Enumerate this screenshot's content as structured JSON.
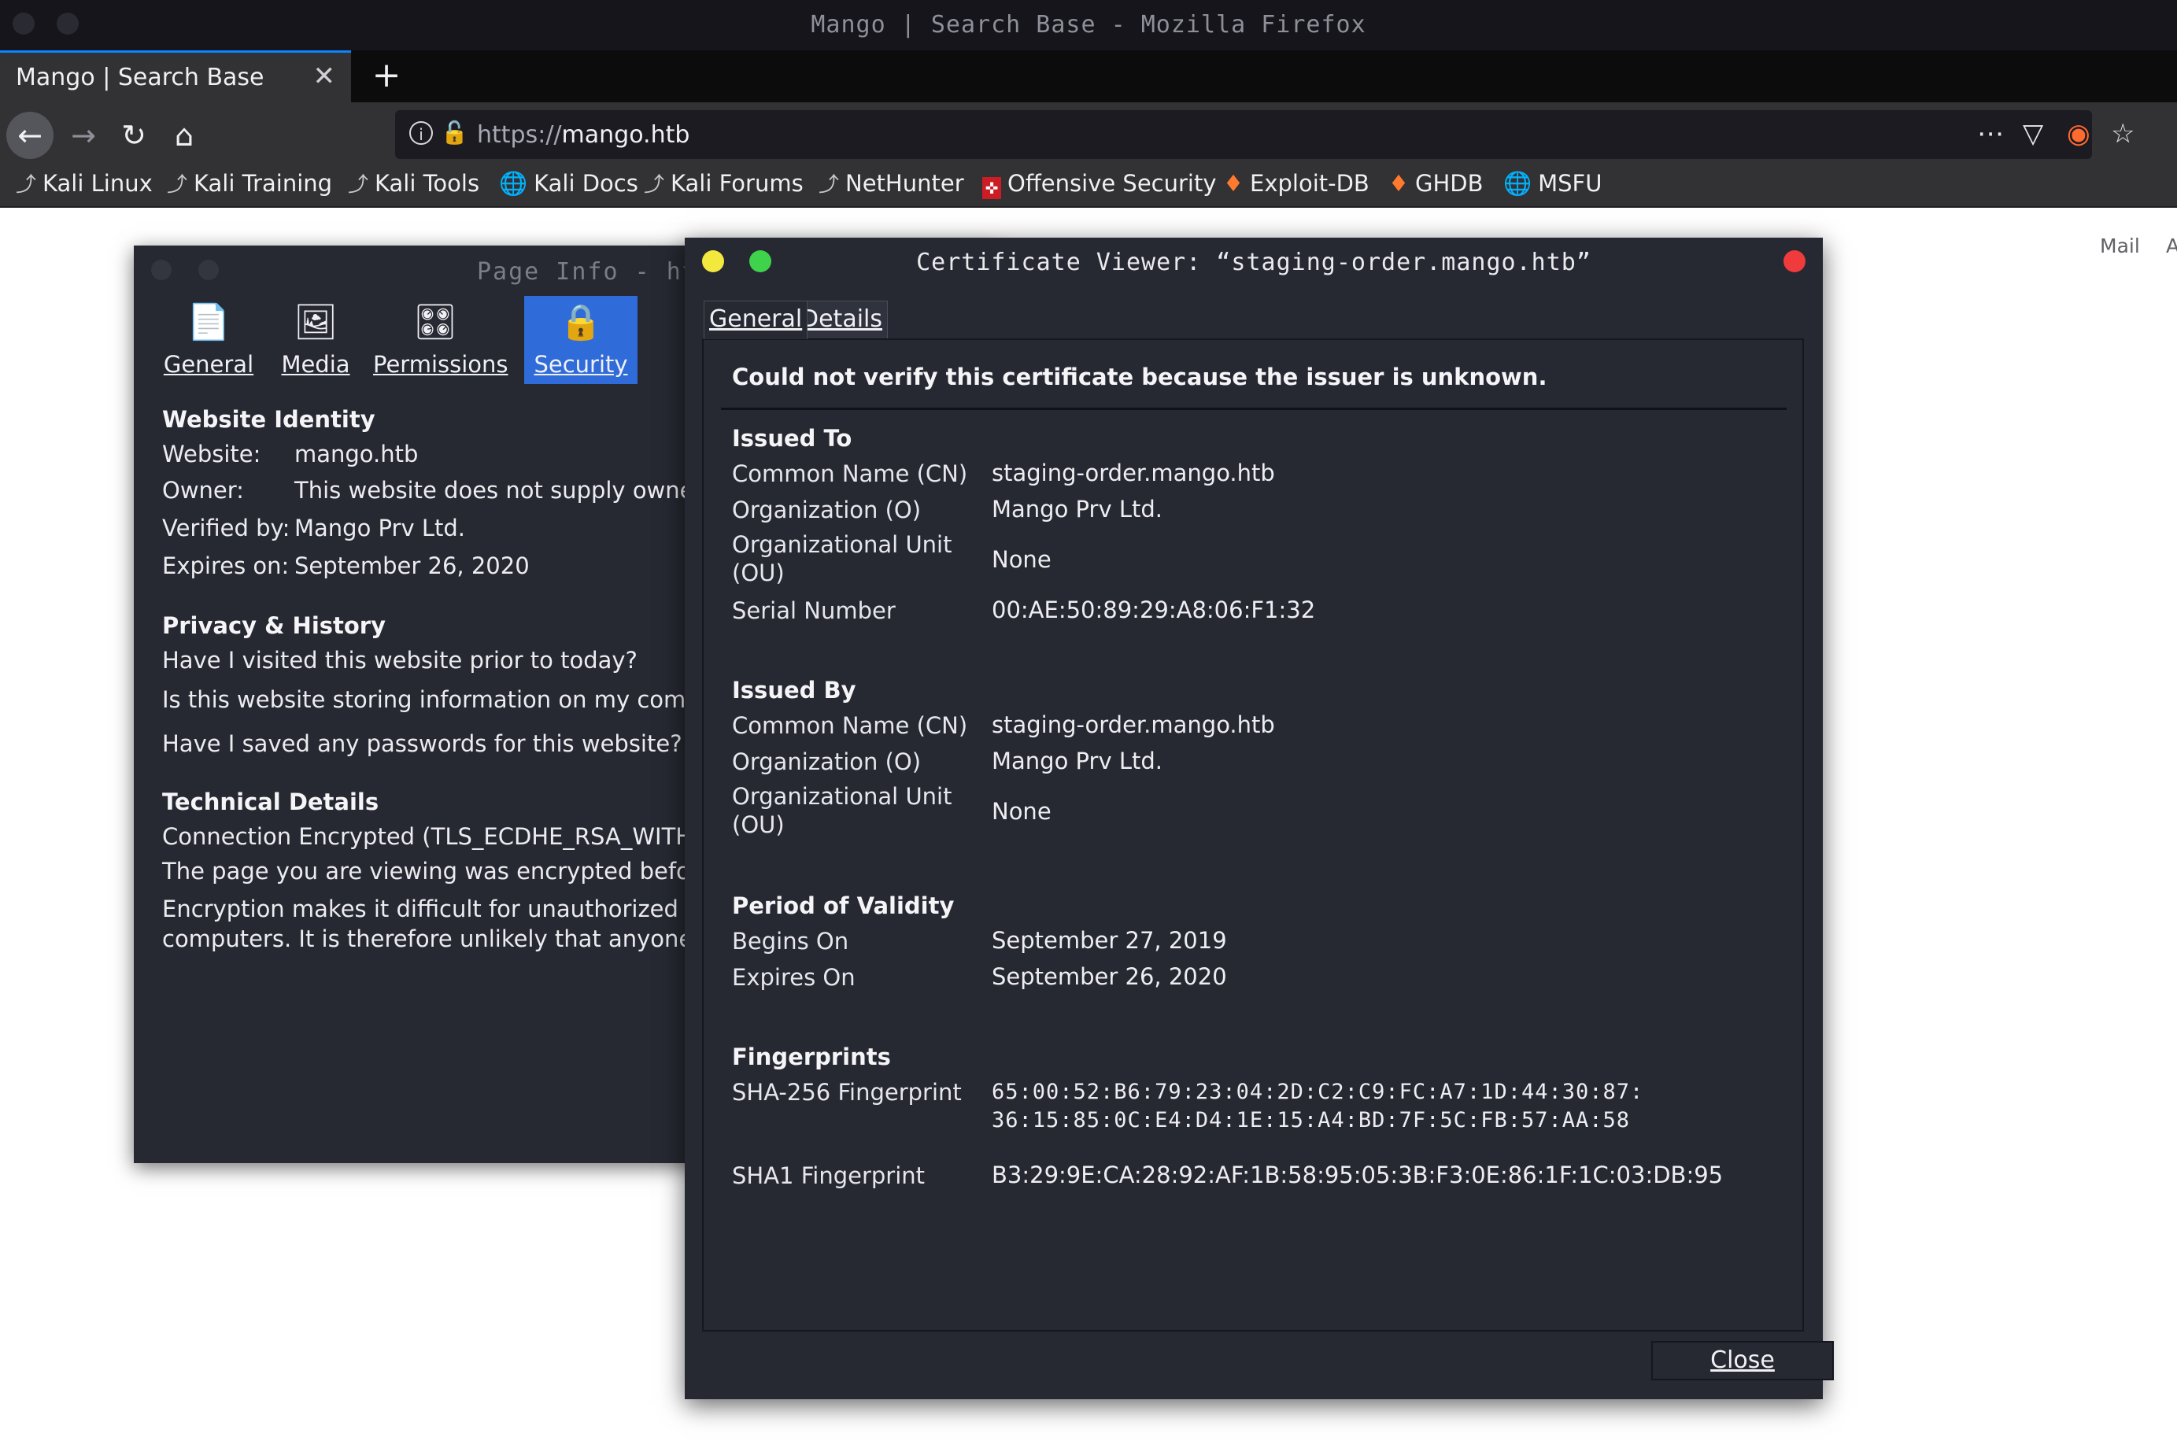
{
  "window": {
    "title": "Mango | Search Base - Mozilla Firefox"
  },
  "tab": {
    "title": "Mango | Search Base",
    "close": "✕",
    "new_tab": "+"
  },
  "urlbar": {
    "scheme": "https://",
    "host": "mango.htb"
  },
  "bookmarks": [
    {
      "label": "Kali Linux",
      "icon": "kali-dragon-icon"
    },
    {
      "label": "Kali Training",
      "icon": "kali-dragon-icon"
    },
    {
      "label": "Kali Tools",
      "icon": "kali-dragon-icon"
    },
    {
      "label": "Kali Docs",
      "icon": "globe-icon"
    },
    {
      "label": "Kali Forums",
      "icon": "kali-dragon-icon"
    },
    {
      "label": "NetHunter",
      "icon": "kali-dragon-icon"
    },
    {
      "label": "Offensive Security",
      "icon": "offsec-icon"
    },
    {
      "label": "Exploit-DB",
      "icon": "exploitdb-icon"
    },
    {
      "label": "GHDB",
      "icon": "exploitdb-icon"
    },
    {
      "label": "MSFU",
      "icon": "globe-icon"
    }
  ],
  "page": {
    "links": {
      "mail": "Mail",
      "truncated": "A"
    }
  },
  "page_info": {
    "title": "Page Info - htt",
    "tabs": {
      "general": "General",
      "media": "Media",
      "permissions": "Permissions",
      "security": "Security",
      "selected": "Security"
    },
    "identity": {
      "heading": "Website Identity",
      "website_label": "Website:",
      "website": "mango.htb",
      "owner_label": "Owner:",
      "owner": "This website does not supply ownershi",
      "verified_label": "Verified by:",
      "verified": "Mango Prv Ltd.",
      "expires_label": "Expires on:",
      "expires": "September 26, 2020"
    },
    "privacy": {
      "heading": "Privacy & History",
      "q1": "Have I visited this website prior to today?",
      "q2": "Is this website storing information on my computer",
      "q3": "Have I saved any passwords for this website?"
    },
    "technical": {
      "heading": "Technical Details",
      "line1": "Connection Encrypted (TLS_ECDHE_RSA_WITH_",
      "line2": "The page you are viewing was encrypted before bei",
      "line3": "Encryption makes it difficult for unauthorized peopl",
      "line4": "computers. It is therefore unlikely that anyone read"
    }
  },
  "cert_viewer": {
    "title": "Certificate Viewer: “staging-order.mango.htb”",
    "tabs": {
      "general": "General",
      "details": "Details"
    },
    "warning": "Could not verify this certificate because the issuer is unknown.",
    "issued_to": {
      "heading": "Issued To",
      "cn_label": "Common Name (CN)",
      "cn": "staging-order.mango.htb",
      "o_label": "Organization (O)",
      "o": "Mango Prv Ltd.",
      "ou_label": "Organizational Unit (OU)",
      "ou": "None",
      "serial_label": "Serial Number",
      "serial": "00:AE:50:89:29:A8:06:F1:32"
    },
    "issued_by": {
      "heading": "Issued By",
      "cn_label": "Common Name (CN)",
      "cn": "staging-order.mango.htb",
      "o_label": "Organization (O)",
      "o": "Mango Prv Ltd.",
      "ou_label": "Organizational Unit (OU)",
      "ou": "None"
    },
    "validity": {
      "heading": "Period of Validity",
      "begins_label": "Begins On",
      "begins": "September 27, 2019",
      "expires_label": "Expires On",
      "expires": "September 26, 2020"
    },
    "fingerprints": {
      "heading": "Fingerprints",
      "sha256_label": "SHA-256 Fingerprint",
      "sha256_line1": "65:00:52:B6:79:23:04:2D:C2:C9:FC:A7:1D:44:30:87:",
      "sha256_line2": "36:15:85:0C:E4:D4:1E:15:A4:BD:7F:5C:FB:57:AA:58",
      "sha1_label": "SHA1 Fingerprint",
      "sha1": "B3:29:9E:CA:28:92:AF:1B:58:95:05:3B:F3:0E:86:1F:1C:03:DB:95"
    },
    "close_label": "Close"
  }
}
